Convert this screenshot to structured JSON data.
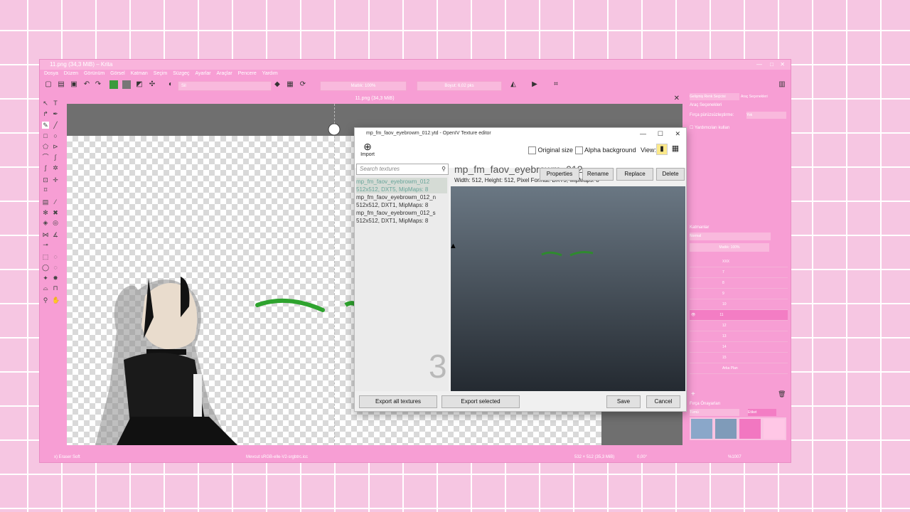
{
  "krita": {
    "title": "11.png (34,3 MiB) – Krita",
    "menu": [
      "Dosya",
      "Düzen",
      "Görünüm",
      "Görsel",
      "Katman",
      "Seçim",
      "Süzgeç",
      "Ayarlar",
      "Araçlar",
      "Pencere",
      "Yardım"
    ],
    "brush_preset": "Sil",
    "opacity_label": "Matlık: 100%",
    "size_label": "Boyut: 6,02 pks",
    "doc_tab": "11.png (34,3 MiB)",
    "right_tabs": [
      "Gelişmiş Renk Seçicisi",
      "Araç Seçenekleri"
    ],
    "tool_options_header": "Araç Seçenekleri",
    "fill_label": "Fırça pürüzsüzleştirme:",
    "fill_value": "Yok",
    "assist_label": "Yardımcıları kullan",
    "layers_header": "Katmanlar",
    "blend_mode": "Normal",
    "layer_opacity": "Matlık: 100%",
    "layers": [
      "XXX",
      "7",
      "8",
      "9",
      "10",
      "11",
      "12",
      "13",
      "14",
      "15",
      "Arka Plan"
    ],
    "presets_header": "Fırça Önayarları",
    "presets_filter": "Tümü",
    "presets_tag": "Etiket",
    "status_left": "x) Eraser Soft",
    "status_mid": "Mevcut sRGB-elle-V2-srgbtrc.icc",
    "status_right": "532 × 512 (35,3 MiB)",
    "status_rot": "0,00°",
    "zoom": "%1007",
    "accent": "#f79ed4"
  },
  "openiv": {
    "title": "mp_fm_faov_eyebrowm_012.ytd - OpenIV Texture editor",
    "import_label": "Import",
    "original_size_label": "Original size",
    "alpha_bg_label": "Alpha background",
    "view_label": "View:",
    "search_placeholder": "Search textures",
    "textures": [
      {
        "name": "mp_fm_faov_eyebrowm_012",
        "info": "512x512, DXT5, MipMaps: 8"
      },
      {
        "name": "mp_fm_faov_eyebrowm_012_n",
        "info": "512x512, DXT1, MipMaps: 8"
      },
      {
        "name": "mp_fm_faov_eyebrowm_012_s",
        "info": "512x512, DXT1, MipMaps: 8"
      }
    ],
    "count": "3",
    "selected_name": "mp_fm_faov_eyebrowm_012",
    "selected_info": "Width: 512, Height: 512, Pixel Format: DXT5, MipMaps: 8",
    "btn_properties": "Properties",
    "btn_rename": "Rename",
    "btn_replace": "Replace",
    "btn_delete": "Delete",
    "btn_export_all": "Export all textures",
    "btn_export_selected": "Export selected",
    "btn_save": "Save",
    "btn_cancel": "Cancel"
  }
}
